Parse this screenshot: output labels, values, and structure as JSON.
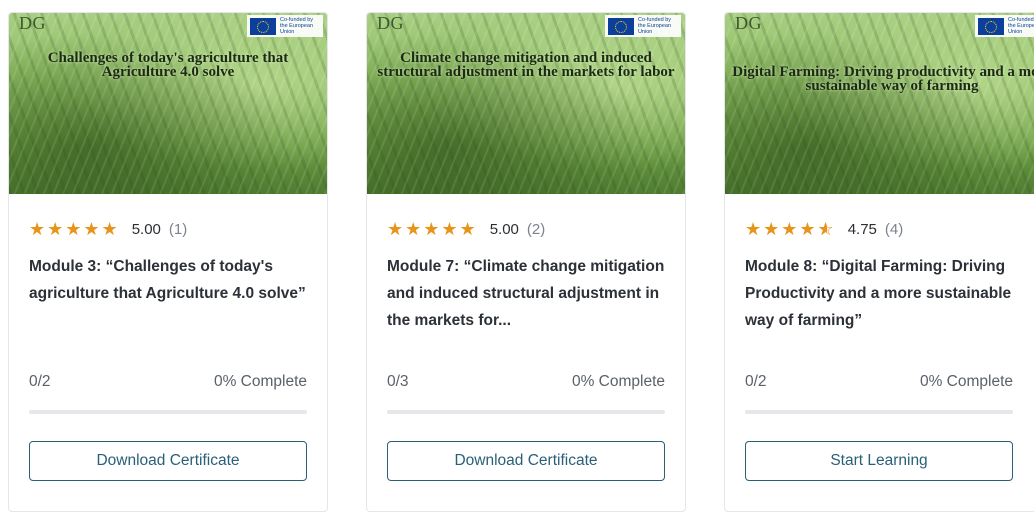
{
  "brand": {
    "logo_text": "DG",
    "eu_text": "Co-funded by the European Union"
  },
  "accent_color": "#2a5f78",
  "star_color": "#e8941a",
  "cards": [
    {
      "banner_title": "Challenges of today's agriculture that Agriculture 4.0 solve",
      "stars": "★★★★★",
      "rating": "5.00",
      "review_count": "(1)",
      "title": "Module 3: “Challenges of today's agriculture that Agriculture 4.0 solve”",
      "lessons": "0/2",
      "complete": "0% Complete",
      "progress": 0,
      "button": "Download Certificate"
    },
    {
      "banner_title": "Climate change mitigation and induced structural adjustment in the markets for labor",
      "stars": "★★★★★",
      "rating": "5.00",
      "review_count": "(2)",
      "title": "Module 7: “Climate change mitigation and induced structural adjustment in the markets for...",
      "lessons": "0/3",
      "complete": "0% Complete",
      "progress": 0,
      "button": "Download Certificate"
    },
    {
      "banner_title": "Digital Farming: Driving productivity and a more sustainable way of farming",
      "stars": "★★★★",
      "rating": "4.75",
      "review_count": "(4)",
      "title": "Module 8: “Digital Farming: Driving Productivity and a more sustainable way of farming”",
      "lessons": "0/2",
      "complete": "0% Complete",
      "progress": 0,
      "button": "Start Learning"
    }
  ]
}
